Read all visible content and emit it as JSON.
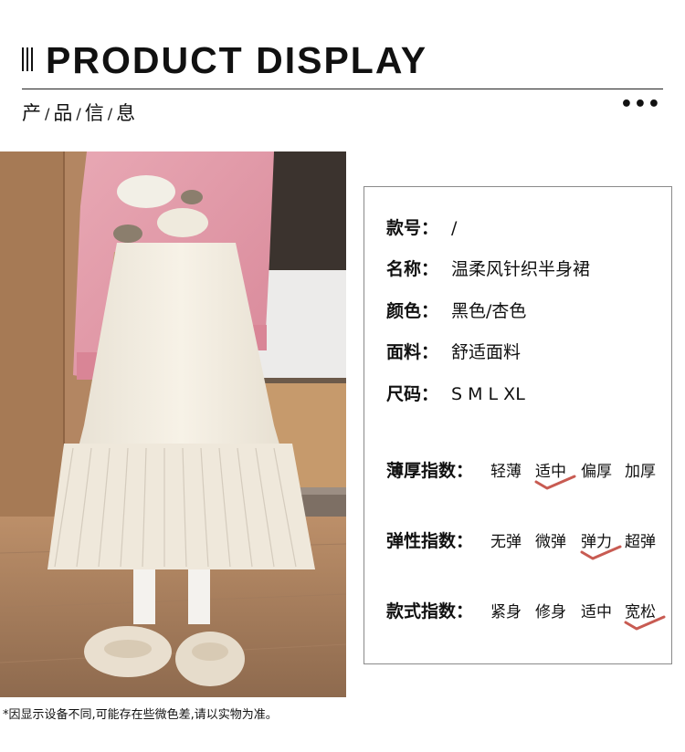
{
  "header": {
    "title": "PRODUCT DISPLAY",
    "subtitle_chars": [
      "产",
      "品",
      "信",
      "息"
    ],
    "separator": "/",
    "more": "•••"
  },
  "photo": {
    "description_icon": "model-photo"
  },
  "info": {
    "style_no": {
      "label": "款号：",
      "value": "/"
    },
    "name": {
      "label": "名称：",
      "value": "温柔风针织半身裙"
    },
    "color": {
      "label": "颜色：",
      "value": "黑色/杏色"
    },
    "fabric": {
      "label": "面料：",
      "value": "舒适面料"
    },
    "size": {
      "label": "尺码：",
      "value": "S M L XL"
    }
  },
  "indexes": [
    {
      "label": "薄厚指数：",
      "options": [
        "轻薄",
        "适中",
        "偏厚",
        "加厚"
      ],
      "selected": 1
    },
    {
      "label": "弹性指数：",
      "options": [
        "无弹",
        "微弹",
        "弹力",
        "超弹"
      ],
      "selected": 2
    },
    {
      "label": "款式指数：",
      "options": [
        "紧身",
        "修身",
        "适中",
        "宽松"
      ],
      "selected": 3
    }
  ],
  "footnote": "*因显示设备不同,可能存在些微色差,请以实物为准。",
  "colors": {
    "check": "#c85b52",
    "panel_border": "#8a8a8a"
  }
}
